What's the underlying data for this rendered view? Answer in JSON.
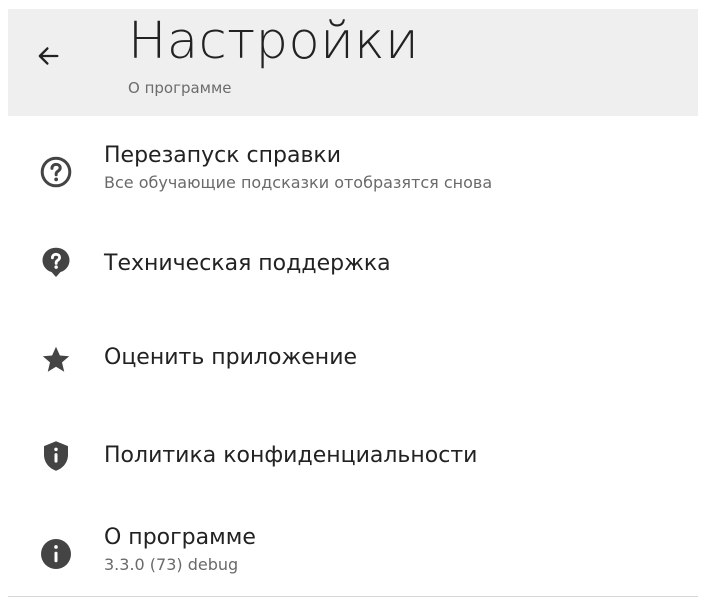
{
  "header": {
    "title": "Настройки",
    "subtitle": "О программе",
    "back_icon": "arrow-left-icon"
  },
  "menu": {
    "items": [
      {
        "id": "restart-help",
        "icon": "help-circle-outline-icon",
        "title": "Перезапуск справки",
        "subtitle": "Все обучающие подсказки отобразятся снова"
      },
      {
        "id": "tech-support",
        "icon": "help-bubble-icon",
        "title": "Техническая поддержка"
      },
      {
        "id": "rate-app",
        "icon": "star-icon",
        "title": "Оценить приложение"
      },
      {
        "id": "privacy-policy",
        "icon": "shield-alert-icon",
        "title": "Политика конфиденциальности"
      },
      {
        "id": "about",
        "icon": "info-circle-icon",
        "title": "О программе",
        "subtitle": "3.3.0 (73) debug"
      }
    ]
  },
  "colors": {
    "header_bg": "#efefef",
    "icon": "#444444",
    "title_text": "#222222",
    "secondary_text": "#6a6a6a"
  }
}
